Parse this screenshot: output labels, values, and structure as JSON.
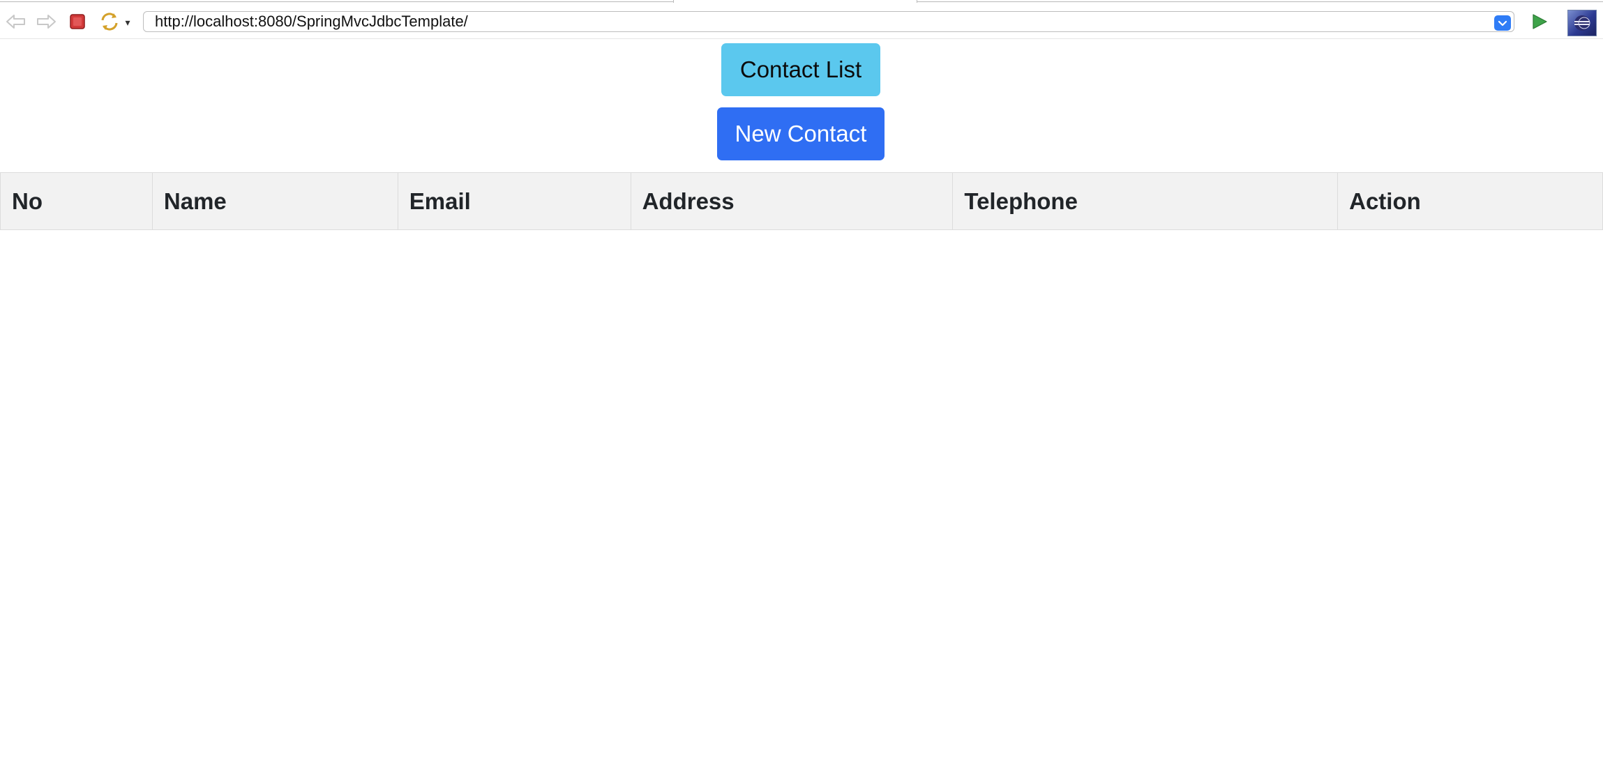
{
  "browser": {
    "url": "http://localhost:8080/SpringMvcJdbcTemplate/",
    "icons": {
      "back": "back-arrow-icon",
      "forward": "forward-arrow-icon",
      "stop": "stop-icon",
      "refresh": "refresh-icon",
      "refresh_menu": "dropdown-arrow-icon",
      "url_history": "url-history-dropdown-icon",
      "go": "go-play-icon",
      "app": "eclipse-icon"
    },
    "colors": {
      "stop": "#d23a3a",
      "go": "#3ea34a",
      "url_dropdown": "#2f7cf6"
    }
  },
  "page": {
    "contact_list_button": "Contact List",
    "new_contact_button": "New Contact",
    "table": {
      "headers": [
        "No",
        "Name",
        "Email",
        "Address",
        "Telephone",
        "Action"
      ],
      "rows": []
    },
    "colors": {
      "contact_list_bg": "#5bc8ee",
      "new_contact_bg": "#2f6ef3",
      "header_bg": "#f2f2f2"
    }
  }
}
